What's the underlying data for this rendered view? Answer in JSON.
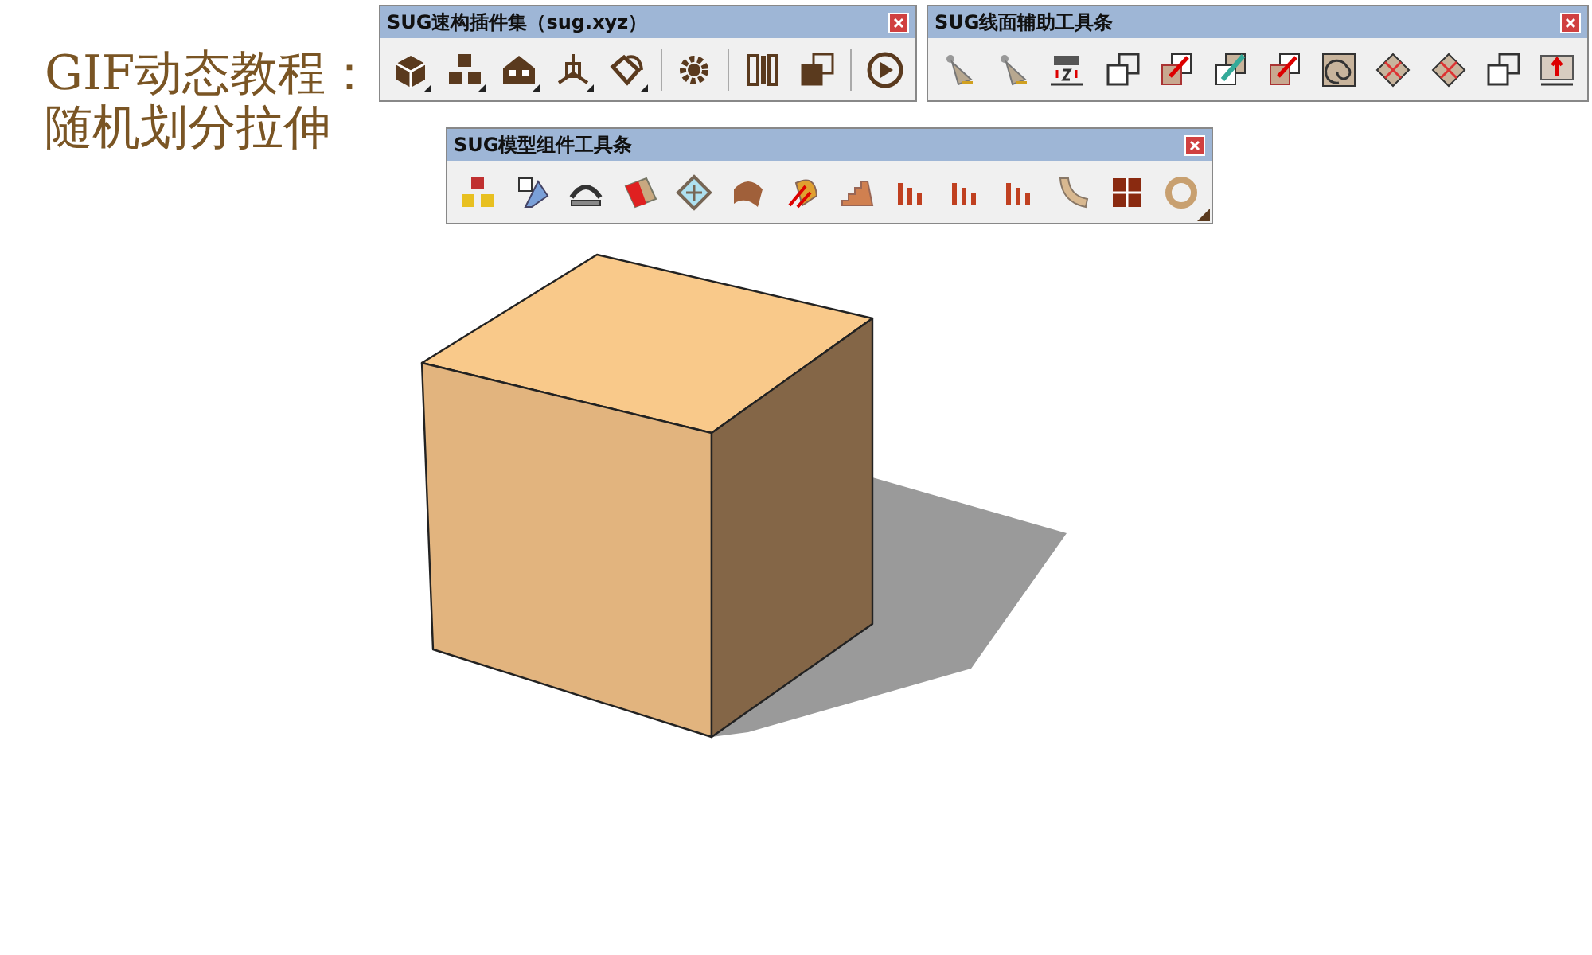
{
  "caption": {
    "lines": [
      "GIF动态教程：",
      "随机划分拉伸"
    ]
  },
  "toolbars": [
    {
      "title": "SUG速构插件集（sug.xyz）",
      "resize_grip": false,
      "items": [
        {
          "kind": "button",
          "dropdown": true
        },
        {
          "kind": "button",
          "dropdown": true
        },
        {
          "kind": "button",
          "dropdown": true
        },
        {
          "kind": "button",
          "dropdown": true
        },
        {
          "kind": "button",
          "dropdown": true
        },
        {
          "kind": "separator"
        },
        {
          "kind": "button",
          "dropdown": false
        },
        {
          "kind": "separator"
        },
        {
          "kind": "button",
          "dropdown": false
        },
        {
          "kind": "button",
          "dropdown": false
        },
        {
          "kind": "separator"
        },
        {
          "kind": "button",
          "dropdown": false
        }
      ]
    },
    {
      "title": "SUG线面辅助工具条",
      "resize_grip": false,
      "items": [
        {
          "kind": "button",
          "dropdown": false
        },
        {
          "kind": "button",
          "dropdown": false
        },
        {
          "kind": "button",
          "dropdown": false
        },
        {
          "kind": "button",
          "dropdown": false
        },
        {
          "kind": "button",
          "dropdown": false
        },
        {
          "kind": "button",
          "dropdown": false
        },
        {
          "kind": "button",
          "dropdown": false
        },
        {
          "kind": "button",
          "dropdown": false
        },
        {
          "kind": "button",
          "dropdown": false
        },
        {
          "kind": "button",
          "dropdown": false
        },
        {
          "kind": "button",
          "dropdown": false
        },
        {
          "kind": "button",
          "dropdown": false
        }
      ]
    },
    {
      "title": "SUG模型组件工具条",
      "resize_grip": true,
      "items": [
        {
          "kind": "button",
          "dropdown": false
        },
        {
          "kind": "button",
          "dropdown": false
        },
        {
          "kind": "button",
          "dropdown": false
        },
        {
          "kind": "button",
          "dropdown": false
        },
        {
          "kind": "button",
          "dropdown": false
        },
        {
          "kind": "button",
          "dropdown": false
        },
        {
          "kind": "button",
          "dropdown": false
        },
        {
          "kind": "button",
          "dropdown": false
        },
        {
          "kind": "button",
          "dropdown": false
        },
        {
          "kind": "button",
          "dropdown": false
        },
        {
          "kind": "button",
          "dropdown": false
        },
        {
          "kind": "button",
          "dropdown": false
        },
        {
          "kind": "button",
          "dropdown": false
        },
        {
          "kind": "button",
          "dropdown": false
        }
      ]
    }
  ]
}
